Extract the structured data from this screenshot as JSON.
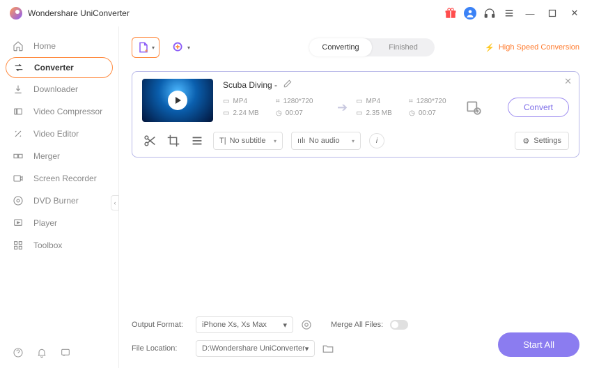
{
  "app_title": "Wondershare UniConverter",
  "sidebar": {
    "items": [
      {
        "label": "Home",
        "icon": "home"
      },
      {
        "label": "Converter",
        "icon": "converter",
        "active": true
      },
      {
        "label": "Downloader",
        "icon": "downloader"
      },
      {
        "label": "Video Compressor",
        "icon": "compressor"
      },
      {
        "label": "Video Editor",
        "icon": "editor"
      },
      {
        "label": "Merger",
        "icon": "merger"
      },
      {
        "label": "Screen Recorder",
        "icon": "recorder"
      },
      {
        "label": "DVD Burner",
        "icon": "dvd"
      },
      {
        "label": "Player",
        "icon": "player"
      },
      {
        "label": "Toolbox",
        "icon": "toolbox"
      }
    ]
  },
  "tabs": {
    "converting": "Converting",
    "finished": "Finished"
  },
  "high_speed_label": "High Speed Conversion",
  "file": {
    "title": "Scuba Diving -",
    "source": {
      "format": "MP4",
      "resolution": "1280*720",
      "size": "2.24 MB",
      "duration": "00:07"
    },
    "target": {
      "format": "MP4",
      "resolution": "1280*720",
      "size": "2.35 MB",
      "duration": "00:07"
    },
    "convert_label": "Convert",
    "subtitle": "No subtitle",
    "audio": "No audio",
    "settings_label": "Settings"
  },
  "bottom": {
    "output_format_label": "Output Format:",
    "output_format_value": "iPhone Xs, Xs Max",
    "merge_label": "Merge All Files:",
    "file_location_label": "File Location:",
    "file_location_value": "D:\\Wondershare UniConverter",
    "start_all": "Start All"
  }
}
